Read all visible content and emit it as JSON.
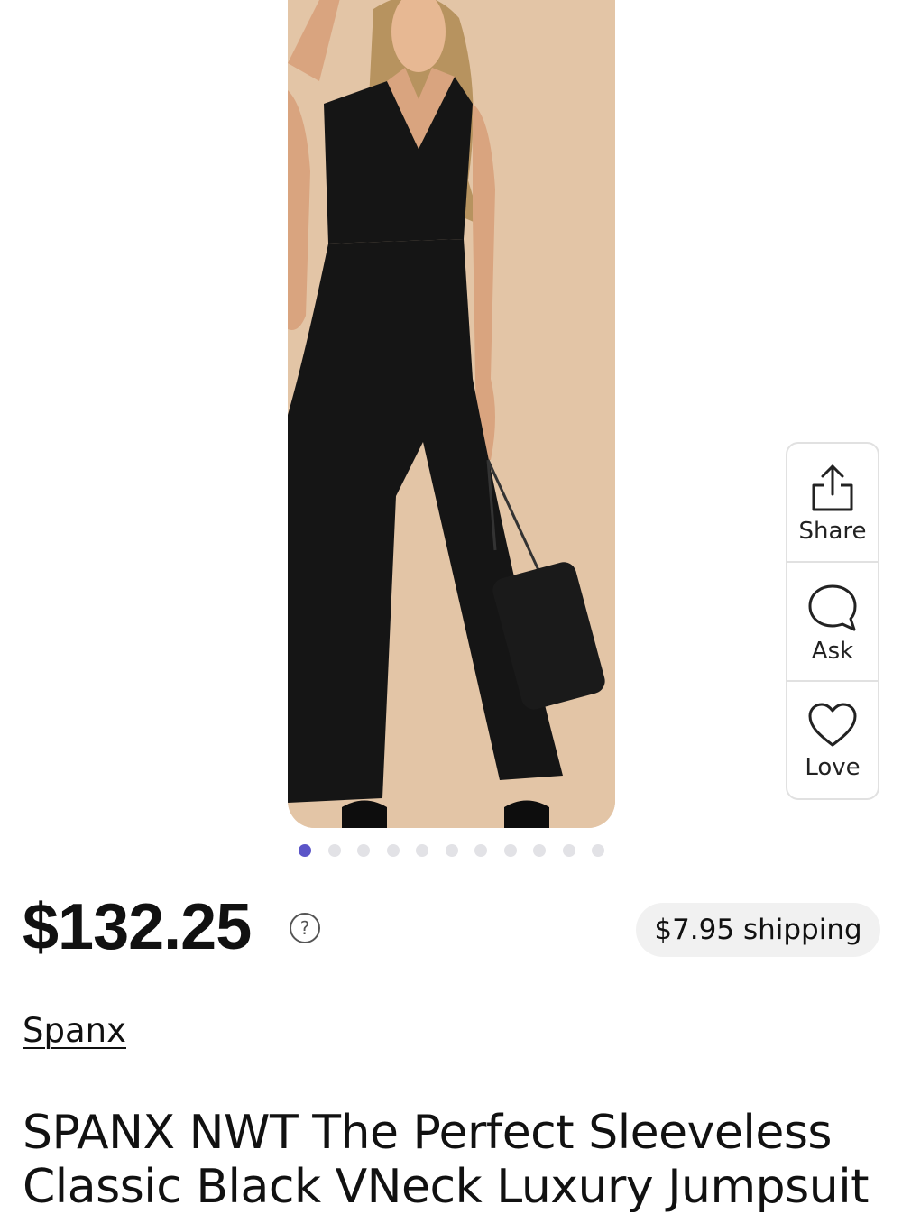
{
  "product": {
    "price": "$132.25",
    "price_help_icon": "question-circle-icon",
    "shipping": "$7.95 shipping",
    "brand": "Spanx",
    "title": "SPANX NWT The Perfect Sleeveless Classic Black VNeck Luxury Jumpsuit"
  },
  "actions": {
    "share_label": "Share",
    "ask_label": "Ask",
    "love_label": "Love"
  },
  "carousel": {
    "total_images": 11,
    "active_index": 0
  },
  "colors": {
    "active_dot": "#5b55c8",
    "inactive_dot": "#e2e2e6",
    "pill_background": "#f1f1f1",
    "photo_background": "#e3c5a6"
  }
}
